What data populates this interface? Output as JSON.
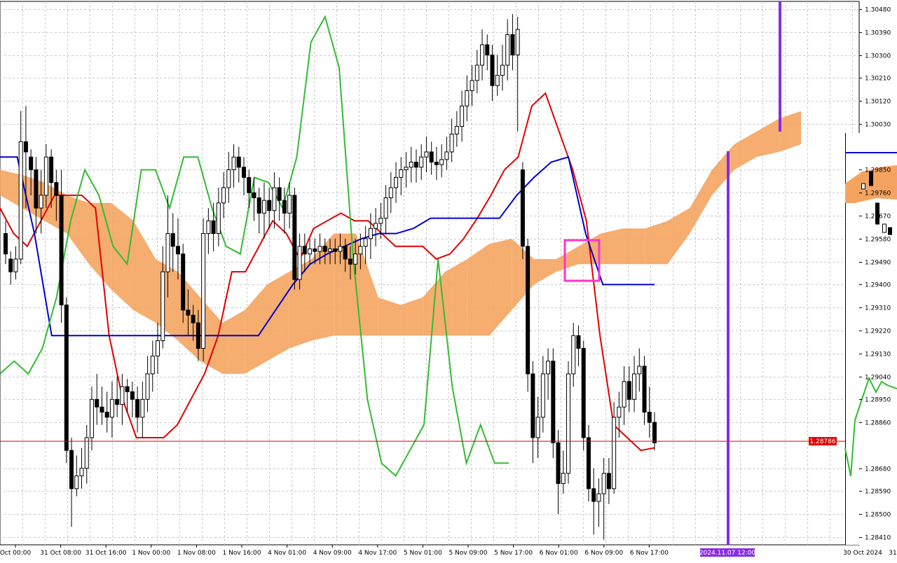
{
  "chart_data": [
    {
      "type": "candlestick",
      "title": "",
      "xlabel": "",
      "ylabel": "",
      "grid": true,
      "ylim": [
        1.2838,
        1.3051
      ],
      "y_ticks": [
        1.3048,
        1.3039,
        1.303,
        1.3021,
        1.3012,
        1.3003,
        1.2985,
        1.2976,
        1.2967,
        1.2958,
        1.2949,
        1.294,
        1.2931,
        1.2922,
        1.2913,
        1.2904,
        1.2895,
        1.2886,
        1.2868,
        1.2859,
        1.285,
        1.2841
      ],
      "y_tick_labels": [
        "1.30480",
        "1.30390",
        "1.30300",
        "1.30210",
        "1.30120",
        "1.30030",
        "1.29850",
        "1.29760",
        "1.29670",
        "1.29580",
        "1.29490",
        "1.29400",
        "1.29310",
        "1.29220",
        "1.29130",
        "1.29040",
        "1.28950",
        "1.28860",
        "1.28680",
        "1.28590",
        "1.28500",
        "1.28410"
      ],
      "x_tick_labels": [
        "Oct 00:00",
        "31 Oct 08:00",
        "31 Oct 16:00",
        "1 Nov 00:00",
        "1 Nov 08:00",
        "1 Nov 16:00",
        "4 Nov 01:00",
        "4 Nov 09:00",
        "4 Nov 17:00",
        "5 Nov 01:00",
        "5 Nov 09:00",
        "5 Nov 17:00",
        "6 Nov 01:00",
        "6 Nov 09:00",
        "6 Nov 17:00"
      ],
      "current_price": 1.28786,
      "current_price_label": "1.28786",
      "cursor_time_label": "2024.11.07 12:00",
      "candles": [
        [
          1.296,
          1.2952,
          1.2965,
          1.2948
        ],
        [
          1.295,
          1.2945,
          1.2953,
          1.294
        ],
        [
          1.2945,
          1.295,
          1.2955,
          1.2942
        ],
        [
          1.295,
          1.2996,
          1.3008,
          1.2948
        ],
        [
          1.2996,
          1.2992,
          1.301,
          1.297
        ],
        [
          1.299,
          1.2985,
          1.2993,
          1.2975
        ],
        [
          1.2985,
          1.297,
          1.299,
          1.296
        ],
        [
          1.297,
          1.2975,
          1.2985,
          1.296
        ],
        [
          1.2975,
          1.299,
          1.2995,
          1.297
        ],
        [
          1.299,
          1.298,
          1.2993,
          1.297
        ],
        [
          1.298,
          1.2975,
          1.2985,
          1.2965
        ],
        [
          1.2975,
          1.2932,
          1.2985,
          1.2925
        ],
        [
          1.2932,
          1.2875,
          1.2935,
          1.287
        ],
        [
          1.2875,
          1.286,
          1.288,
          1.2845
        ],
        [
          1.286,
          1.2865,
          1.2873,
          1.2857
        ],
        [
          1.2865,
          1.2868,
          1.2876,
          1.286
        ],
        [
          1.2868,
          1.288,
          1.2885,
          1.2862
        ],
        [
          1.288,
          1.2895,
          1.29,
          1.2875
        ],
        [
          1.2895,
          1.2892,
          1.2905,
          1.2885
        ],
        [
          1.2892,
          1.289,
          1.29,
          1.2885
        ],
        [
          1.289,
          1.2888,
          1.2898,
          1.2882
        ],
        [
          1.2888,
          1.2895,
          1.2902,
          1.288
        ],
        [
          1.2895,
          1.2893,
          1.2904,
          1.2888
        ],
        [
          1.2893,
          1.29,
          1.2905,
          1.2885
        ],
        [
          1.29,
          1.2898,
          1.2903,
          1.289
        ],
        [
          1.2898,
          1.2895,
          1.2902,
          1.2888
        ],
        [
          1.2895,
          1.2888,
          1.29,
          1.2882
        ],
        [
          1.2888,
          1.2895,
          1.2902,
          1.288
        ],
        [
          1.2895,
          1.2905,
          1.2912,
          1.289
        ],
        [
          1.2905,
          1.2912,
          1.2918,
          1.2898
        ],
        [
          1.2912,
          1.2918,
          1.2925,
          1.2905
        ],
        [
          1.2918,
          1.2945,
          1.2955,
          1.2915
        ],
        [
          1.2945,
          1.296,
          1.2975,
          1.2935
        ],
        [
          1.296,
          1.2955,
          1.2968,
          1.2945
        ],
        [
          1.2955,
          1.2952,
          1.2966,
          1.2942
        ],
        [
          1.2952,
          1.293,
          1.2956,
          1.2925
        ],
        [
          1.293,
          1.2928,
          1.2938,
          1.292
        ],
        [
          1.2928,
          1.2925,
          1.2932,
          1.2918
        ],
        [
          1.2925,
          1.2915,
          1.293,
          1.291
        ],
        [
          1.2915,
          1.296,
          1.2966,
          1.291
        ],
        [
          1.296,
          1.2965,
          1.297,
          1.2952
        ],
        [
          1.2965,
          1.296,
          1.2972,
          1.2953
        ],
        [
          1.296,
          1.2972,
          1.2978,
          1.2955
        ],
        [
          1.2972,
          1.2978,
          1.2984,
          1.2966
        ],
        [
          1.2978,
          1.2985,
          1.2992,
          1.2972
        ],
        [
          1.2985,
          1.299,
          1.2995,
          1.2978
        ],
        [
          1.299,
          1.2986,
          1.2994,
          1.298
        ],
        [
          1.2986,
          1.2982,
          1.299,
          1.2975
        ],
        [
          1.2982,
          1.2976,
          1.2985,
          1.297
        ],
        [
          1.2976,
          1.2974,
          1.2982,
          1.2965
        ],
        [
          1.2974,
          1.2968,
          1.2978,
          1.296
        ],
        [
          1.2968,
          1.2973,
          1.298,
          1.2958
        ],
        [
          1.2973,
          1.2969,
          1.2978,
          1.2962
        ],
        [
          1.2969,
          1.2978,
          1.2984,
          1.2962
        ],
        [
          1.2978,
          1.2973,
          1.2982,
          1.2965
        ],
        [
          1.2973,
          1.2968,
          1.2978,
          1.296
        ],
        [
          1.2968,
          1.2975,
          1.298,
          1.2962
        ],
        [
          1.2975,
          1.2942,
          1.2978,
          1.2938
        ],
        [
          1.2942,
          1.2955,
          1.296,
          1.2938
        ],
        [
          1.2955,
          1.2952,
          1.296,
          1.2945
        ],
        [
          1.2952,
          1.2954,
          1.2958,
          1.2948
        ],
        [
          1.2954,
          1.2953,
          1.2958,
          1.2948
        ],
        [
          1.2953,
          1.2955,
          1.296,
          1.2948
        ],
        [
          1.2955,
          1.2953,
          1.2958,
          1.2948
        ],
        [
          1.2953,
          1.2954,
          1.2958,
          1.2948
        ],
        [
          1.2954,
          1.2953,
          1.2958,
          1.2948
        ],
        [
          1.2953,
          1.2955,
          1.296,
          1.2948
        ],
        [
          1.2955,
          1.295,
          1.2958,
          1.2945
        ],
        [
          1.295,
          1.2948,
          1.2955,
          1.2942
        ],
        [
          1.2948,
          1.2952,
          1.2958,
          1.2944
        ],
        [
          1.2952,
          1.2955,
          1.296,
          1.2946
        ],
        [
          1.2955,
          1.2958,
          1.2963,
          1.2948
        ],
        [
          1.2958,
          1.2962,
          1.2968,
          1.295
        ],
        [
          1.2962,
          1.2964,
          1.297,
          1.2955
        ],
        [
          1.2964,
          1.2966,
          1.2972,
          1.2958
        ],
        [
          1.2966,
          1.2974,
          1.2979,
          1.296
        ],
        [
          1.2974,
          1.2978,
          1.2984,
          1.2968
        ],
        [
          1.2978,
          1.2982,
          1.2988,
          1.2972
        ],
        [
          1.2982,
          1.2985,
          1.299,
          1.2975
        ],
        [
          1.2985,
          1.2986,
          1.2992,
          1.2978
        ],
        [
          1.2986,
          1.2988,
          1.2994,
          1.298
        ],
        [
          1.2988,
          1.2986,
          1.2993,
          1.298
        ],
        [
          1.2986,
          1.299,
          1.2995,
          1.2981
        ],
        [
          1.299,
          1.2992,
          1.2998,
          1.2984
        ],
        [
          1.2992,
          1.2988,
          1.2996,
          1.2983
        ],
        [
          1.2988,
          1.2987,
          1.2994,
          1.2981
        ],
        [
          1.2987,
          1.2989,
          1.2995,
          1.2982
        ],
        [
          1.2989,
          1.2992,
          1.2998,
          1.2985
        ],
        [
          1.2992,
          1.2999,
          1.3005,
          1.2988
        ],
        [
          1.2999,
          1.3002,
          1.3008,
          1.2994
        ],
        [
          1.3002,
          1.301,
          1.3016,
          1.2996
        ],
        [
          1.301,
          1.3016,
          1.3022,
          1.3004
        ],
        [
          1.3016,
          1.302,
          1.3026,
          1.301
        ],
        [
          1.302,
          1.3026,
          1.3032,
          1.3015
        ],
        [
          1.3026,
          1.3034,
          1.304,
          1.302
        ],
        [
          1.3034,
          1.303,
          1.3038,
          1.3024
        ],
        [
          1.303,
          1.3018,
          1.3034,
          1.3012
        ],
        [
          1.3018,
          1.3022,
          1.303,
          1.3014
        ],
        [
          1.3022,
          1.3026,
          1.3034,
          1.3016
        ],
        [
          1.3026,
          1.3038,
          1.3044,
          1.302
        ],
        [
          1.3038,
          1.303,
          1.3046,
          1.3024
        ],
        [
          1.303,
          1.304,
          1.3045,
          1.3
        ],
        [
          1.2985,
          1.2955,
          1.2988,
          1.295
        ],
        [
          1.2955,
          1.2905,
          1.2958,
          1.2898
        ],
        [
          1.2905,
          1.288,
          1.291,
          1.287
        ],
        [
          1.288,
          1.2888,
          1.2896,
          1.2872
        ],
        [
          1.2888,
          1.2905,
          1.2912,
          1.2882
        ],
        [
          1.2905,
          1.291,
          1.2915,
          1.2895
        ],
        [
          1.291,
          1.2878,
          1.2915,
          1.2872
        ],
        [
          1.2878,
          1.2862,
          1.2883,
          1.285
        ],
        [
          1.2862,
          1.2866,
          1.2875,
          1.2858
        ],
        [
          1.2866,
          1.2905,
          1.291,
          1.2862
        ],
        [
          1.2905,
          1.292,
          1.2925,
          1.29
        ],
        [
          1.292,
          1.2915,
          1.2924,
          1.2908
        ],
        [
          1.2915,
          1.288,
          1.2918,
          1.2875
        ],
        [
          1.288,
          1.286,
          1.2885,
          1.2855
        ],
        [
          1.286,
          1.2855,
          1.2868,
          1.2842
        ],
        [
          1.2855,
          1.2858,
          1.2864,
          1.2845
        ],
        [
          1.2858,
          1.2866,
          1.2872,
          1.284
        ],
        [
          1.2866,
          1.286,
          1.2872,
          1.2854
        ],
        [
          1.286,
          1.2888,
          1.2894,
          1.2858
        ],
        [
          1.2888,
          1.2892,
          1.2898,
          1.288
        ],
        [
          1.2892,
          1.2902,
          1.2908,
          1.2885
        ],
        [
          1.2902,
          1.2895,
          1.2908,
          1.289
        ],
        [
          1.2895,
          1.2905,
          1.2912,
          1.289
        ],
        [
          1.2905,
          1.2908,
          1.2915,
          1.2898
        ],
        [
          1.2908,
          1.289,
          1.2912,
          1.2885
        ],
        [
          1.289,
          1.2886,
          1.29,
          1.288
        ],
        [
          1.2886,
          1.2878,
          1.289,
          1.2875
        ]
      ],
      "series": [
        {
          "values": [
            1.297,
            1.296,
            1.2955,
            1.2965,
            1.2975,
            1.2975,
            1.2975,
            1.297,
            1.292,
            1.2895,
            1.288,
            1.288,
            1.288,
            1.2885,
            1.2895,
            1.2905,
            1.292,
            1.2945,
            1.2945,
            1.2955,
            1.2965,
            1.296,
            1.295,
            1.2962,
            1.2965,
            1.2968,
            1.2965,
            1.2965,
            1.296,
            1.2955,
            1.2955,
            1.2955,
            1.295,
            1.2952,
            1.2958,
            1.2966,
            1.2975,
            1.2985,
            1.299,
            1.301,
            1.3015,
            1.3,
            1.2985,
            1.2965,
            1.292,
            1.2885,
            1.288,
            1.2875,
            1.2876
          ]
        },
        {
          "values": [
            1.299,
            1.299,
            1.296,
            1.292,
            1.292,
            1.292,
            1.292,
            1.292,
            1.292,
            1.292,
            1.292,
            1.292,
            1.292,
            1.292,
            1.292,
            1.292,
            1.293,
            1.294,
            1.2948,
            1.2952,
            1.2955,
            1.2958,
            1.296,
            1.296,
            1.2962,
            1.2966,
            1.2966,
            1.2966,
            1.2966,
            1.2966,
            1.2975,
            1.2982,
            1.2988,
            1.299,
            1.296,
            1.294,
            1.294,
            1.294,
            1.294
          ]
        },
        {
          "values": [
            1.2905,
            1.291,
            1.2905,
            1.2915,
            1.2935,
            1.2965,
            1.2985,
            1.2975,
            1.2955,
            1.2948,
            1.2985,
            1.2985,
            1.297,
            1.299,
            1.299,
            1.297,
            1.2955,
            1.2952,
            1.2982,
            1.298,
            1.297,
            1.299,
            1.3035,
            1.3045,
            1.3025,
            1.295,
            1.2895,
            1.287,
            1.2865,
            1.2875,
            1.2885,
            1.295,
            1.29,
            1.287,
            1.2885,
            1.287,
            1.287
          ]
        }
      ],
      "cloud": {
        "span_a": [
          1.2985,
          1.2983,
          1.298,
          1.2975,
          1.2972,
          1.2972,
          1.2965,
          1.295,
          1.2945,
          1.2935,
          1.2925,
          1.293,
          1.294,
          1.2945,
          1.295,
          1.296,
          1.296,
          1.2935,
          1.2932,
          1.2935,
          1.2945,
          1.295,
          1.2956,
          1.2958,
          1.295,
          1.295,
          1.2955,
          1.296,
          1.2962,
          1.2962,
          1.2965,
          1.297,
          1.2985,
          1.2995,
          1.3,
          1.3005,
          1.3008
        ],
        "span_b": [
          1.2975,
          1.297,
          1.2965,
          1.296,
          1.2948,
          1.2938,
          1.293,
          1.2925,
          1.2918,
          1.291,
          1.2905,
          1.2905,
          1.291,
          1.2915,
          1.2918,
          1.292,
          1.292,
          1.292,
          1.292,
          1.292,
          1.292,
          1.292,
          1.292,
          1.293,
          1.294,
          1.2945,
          1.2948,
          1.2948,
          1.2948,
          1.2948,
          1.2948,
          1.296,
          1.2975,
          1.2985,
          1.299,
          1.2992,
          1.2995
        ]
      }
    },
    {
      "type": "candlestick",
      "title": "",
      "xlabel": "",
      "ylabel": "",
      "grid": true,
      "x_tick_labels": [
        "30 Oct 2024",
        "31"
      ]
    }
  ]
}
